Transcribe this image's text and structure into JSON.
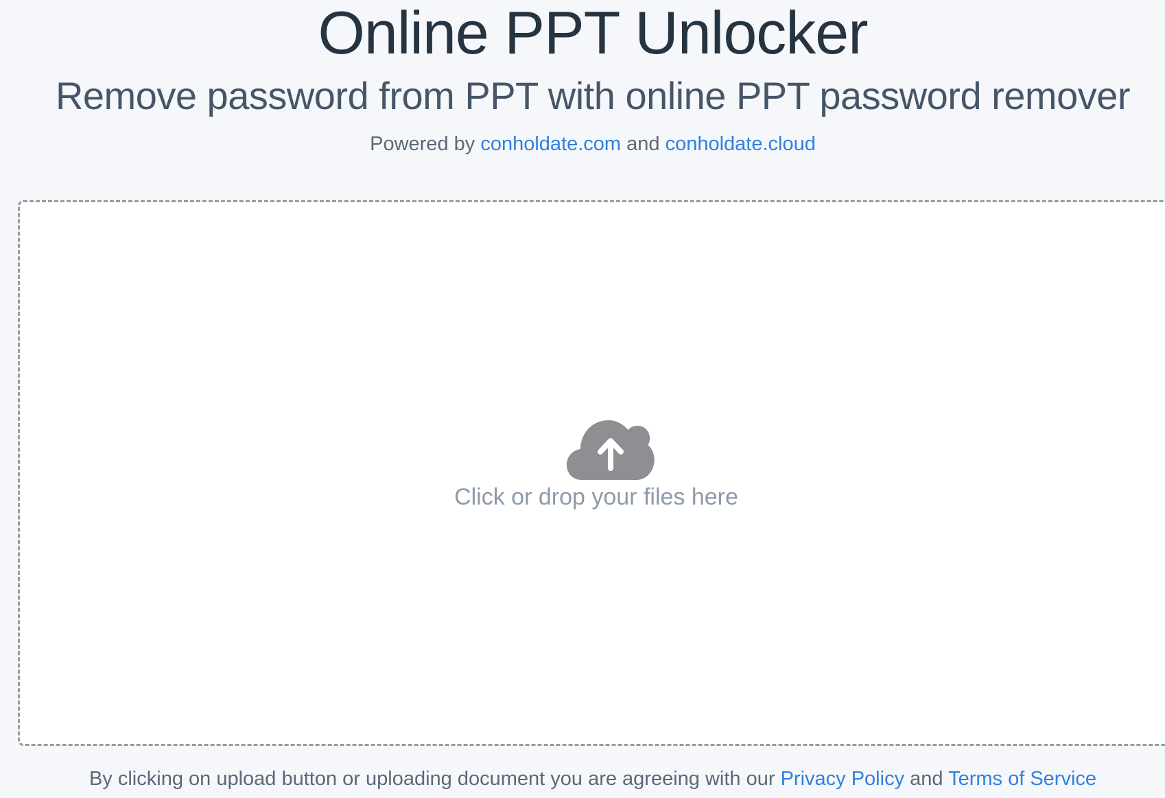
{
  "header": {
    "title": "Online PPT Unlocker",
    "subtitle": "Remove password from PPT with online PPT password remover",
    "powered_prefix": "Powered by",
    "powered_link_1": "conholdate.com",
    "powered_and": "and",
    "powered_link_2": "conholdate.cloud"
  },
  "dropzone": {
    "icon": "cloud-upload-icon",
    "text": "Click or drop your files here"
  },
  "footer": {
    "agreement_text": "By clicking on upload button or uploading document you are agreeing with our",
    "privacy_link": "Privacy Policy",
    "and_text": "and",
    "terms_link": "Terms of Service"
  },
  "colors": {
    "background": "#f5f7fa",
    "link": "#2f80e0",
    "title": "#263340",
    "icon": "#8f8f93"
  }
}
